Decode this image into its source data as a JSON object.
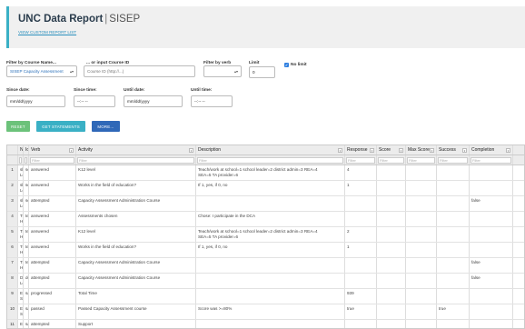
{
  "header": {
    "title": "UNC Data Report",
    "separator": "|",
    "subtitle": "SISEP",
    "view_link": "VIEW CUSTOM REPORT LIST"
  },
  "filters": {
    "course_name_label": "Filter by Course Name...",
    "course_name_value": "SISEP Capacity Assessment",
    "course_id_label": "... or input Course ID",
    "course_id_placeholder": "Course ID (http://...)",
    "verb_label": "Filter by verb",
    "verb_value": "",
    "limit_label": "Limit",
    "limit_value": "0",
    "no_limit_label": "No limit",
    "no_limit_checked": true,
    "since_date_label": "Since date:",
    "since_date_value": "mm/dd/yyyy",
    "since_time_label": "Since time:",
    "since_time_value": "--:-- --",
    "until_date_label": "Until date:",
    "until_date_value": "mm/dd/yyyy",
    "until_time_label": "Until time:",
    "until_time_value": "--:-- --"
  },
  "buttons": {
    "reset": "RESET",
    "get_statements": "GET STATEMENTS",
    "more": "MORE...",
    "reset_color": "#6cc27a",
    "get_color": "#3ab0c5",
    "more_color": "#2f68b8"
  },
  "table": {
    "columns": [
      "",
      "Na",
      "Id",
      "Verb",
      "Activity",
      "Description",
      "Response",
      "Score",
      "Max Score",
      "Success",
      "Completion"
    ],
    "filter_short": "Fi",
    "filter_placeholder": "Filter",
    "rows": [
      {
        "n": "1",
        "name": "shi\nLey",
        "id": "sel",
        "verb": "answered",
        "activity": "K12 level",
        "desc": "Teach/work at school=1 school leader=2 district admin=3 REA=4\nSEA=5 TA provider=6",
        "response": "4",
        "score": "",
        "max": "",
        "success": "",
        "completion": ""
      },
      {
        "n": "2",
        "name": "shi\nLey",
        "id": "sel",
        "verb": "answered",
        "activity": "Works in the field of education?",
        "desc": "If 1, yes, if 0, no",
        "response": "1",
        "score": "",
        "max": "",
        "success": "",
        "completion": ""
      },
      {
        "n": "3",
        "name": "shi\nLey",
        "id": "sel",
        "verb": "attempted",
        "activity": "Capacity Assessment Administration Course",
        "desc": "",
        "response": "",
        "score": "",
        "max": "",
        "success": "",
        "completion": "false"
      },
      {
        "n": "4",
        "name": "Tim\nHe",
        "id": "ter",
        "verb": "answered",
        "activity": "Assessments chosen",
        "desc": "Chose: I participate in the DCA",
        "response": "",
        "score": "",
        "max": "",
        "success": "",
        "completion": ""
      },
      {
        "n": "5",
        "name": "Tim\nHe",
        "id": "ter",
        "verb": "answered",
        "activity": "K12 level",
        "desc": "Teach/work at school=1 school leader=2 district admin=3 REA=4\nSEA=5 TA provider=6",
        "response": "2",
        "score": "",
        "max": "",
        "success": "",
        "completion": ""
      },
      {
        "n": "6",
        "name": "Tim\nHe",
        "id": "ter",
        "verb": "answered",
        "activity": "Works in the field of education?",
        "desc": "If 1, yes, if 0, no",
        "response": "1",
        "score": "",
        "max": "",
        "success": "",
        "completion": ""
      },
      {
        "n": "7",
        "name": "Tim\nHe",
        "id": "ter",
        "verb": "attempted",
        "activity": "Capacity Assessment Administration Course",
        "desc": "",
        "response": "",
        "score": "",
        "max": "",
        "success": "",
        "completion": "false"
      },
      {
        "n": "8",
        "name": "Do\nLey",
        "id": "dol",
        "verb": "attempted",
        "activity": "Capacity Assessment Administration Course",
        "desc": "",
        "response": "",
        "score": "",
        "max": "",
        "success": "",
        "completion": "false"
      },
      {
        "n": "9",
        "name": "Em\nSa",
        "id": "sal",
        "verb": "progressed",
        "activity": "Total Time",
        "desc": "",
        "response": "939",
        "score": "",
        "max": "",
        "success": "",
        "completion": ""
      },
      {
        "n": "10",
        "name": "Em\nSa",
        "id": "sal",
        "verb": "passed",
        "activity": "Passed Capacity Assessment course",
        "desc": "Score was >=80%",
        "response": "true",
        "score": "",
        "max": "",
        "success": "true",
        "completion": ""
      },
      {
        "n": "11",
        "name": "Em",
        "id": "sal",
        "verb": "attempted",
        "activity": "Support",
        "desc": "",
        "response": "",
        "score": "",
        "max": "",
        "success": "",
        "completion": ""
      }
    ]
  }
}
